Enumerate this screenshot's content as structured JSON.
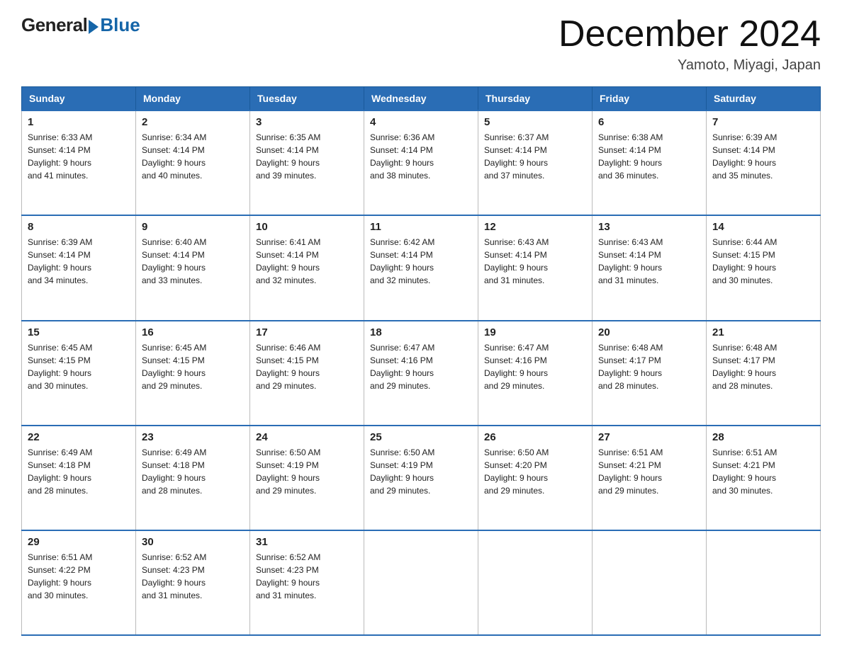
{
  "logo": {
    "general": "General",
    "blue": "Blue"
  },
  "title": "December 2024",
  "subtitle": "Yamoto, Miyagi, Japan",
  "days": [
    "Sunday",
    "Monday",
    "Tuesday",
    "Wednesday",
    "Thursday",
    "Friday",
    "Saturday"
  ],
  "weeks": [
    [
      {
        "day": "1",
        "sunrise": "6:33 AM",
        "sunset": "4:14 PM",
        "daylight": "9 hours and 41 minutes."
      },
      {
        "day": "2",
        "sunrise": "6:34 AM",
        "sunset": "4:14 PM",
        "daylight": "9 hours and 40 minutes."
      },
      {
        "day": "3",
        "sunrise": "6:35 AM",
        "sunset": "4:14 PM",
        "daylight": "9 hours and 39 minutes."
      },
      {
        "day": "4",
        "sunrise": "6:36 AM",
        "sunset": "4:14 PM",
        "daylight": "9 hours and 38 minutes."
      },
      {
        "day": "5",
        "sunrise": "6:37 AM",
        "sunset": "4:14 PM",
        "daylight": "9 hours and 37 minutes."
      },
      {
        "day": "6",
        "sunrise": "6:38 AM",
        "sunset": "4:14 PM",
        "daylight": "9 hours and 36 minutes."
      },
      {
        "day": "7",
        "sunrise": "6:39 AM",
        "sunset": "4:14 PM",
        "daylight": "9 hours and 35 minutes."
      }
    ],
    [
      {
        "day": "8",
        "sunrise": "6:39 AM",
        "sunset": "4:14 PM",
        "daylight": "9 hours and 34 minutes."
      },
      {
        "day": "9",
        "sunrise": "6:40 AM",
        "sunset": "4:14 PM",
        "daylight": "9 hours and 33 minutes."
      },
      {
        "day": "10",
        "sunrise": "6:41 AM",
        "sunset": "4:14 PM",
        "daylight": "9 hours and 32 minutes."
      },
      {
        "day": "11",
        "sunrise": "6:42 AM",
        "sunset": "4:14 PM",
        "daylight": "9 hours and 32 minutes."
      },
      {
        "day": "12",
        "sunrise": "6:43 AM",
        "sunset": "4:14 PM",
        "daylight": "9 hours and 31 minutes."
      },
      {
        "day": "13",
        "sunrise": "6:43 AM",
        "sunset": "4:14 PM",
        "daylight": "9 hours and 31 minutes."
      },
      {
        "day": "14",
        "sunrise": "6:44 AM",
        "sunset": "4:15 PM",
        "daylight": "9 hours and 30 minutes."
      }
    ],
    [
      {
        "day": "15",
        "sunrise": "6:45 AM",
        "sunset": "4:15 PM",
        "daylight": "9 hours and 30 minutes."
      },
      {
        "day": "16",
        "sunrise": "6:45 AM",
        "sunset": "4:15 PM",
        "daylight": "9 hours and 29 minutes."
      },
      {
        "day": "17",
        "sunrise": "6:46 AM",
        "sunset": "4:15 PM",
        "daylight": "9 hours and 29 minutes."
      },
      {
        "day": "18",
        "sunrise": "6:47 AM",
        "sunset": "4:16 PM",
        "daylight": "9 hours and 29 minutes."
      },
      {
        "day": "19",
        "sunrise": "6:47 AM",
        "sunset": "4:16 PM",
        "daylight": "9 hours and 29 minutes."
      },
      {
        "day": "20",
        "sunrise": "6:48 AM",
        "sunset": "4:17 PM",
        "daylight": "9 hours and 28 minutes."
      },
      {
        "day": "21",
        "sunrise": "6:48 AM",
        "sunset": "4:17 PM",
        "daylight": "9 hours and 28 minutes."
      }
    ],
    [
      {
        "day": "22",
        "sunrise": "6:49 AM",
        "sunset": "4:18 PM",
        "daylight": "9 hours and 28 minutes."
      },
      {
        "day": "23",
        "sunrise": "6:49 AM",
        "sunset": "4:18 PM",
        "daylight": "9 hours and 28 minutes."
      },
      {
        "day": "24",
        "sunrise": "6:50 AM",
        "sunset": "4:19 PM",
        "daylight": "9 hours and 29 minutes."
      },
      {
        "day": "25",
        "sunrise": "6:50 AM",
        "sunset": "4:19 PM",
        "daylight": "9 hours and 29 minutes."
      },
      {
        "day": "26",
        "sunrise": "6:50 AM",
        "sunset": "4:20 PM",
        "daylight": "9 hours and 29 minutes."
      },
      {
        "day": "27",
        "sunrise": "6:51 AM",
        "sunset": "4:21 PM",
        "daylight": "9 hours and 29 minutes."
      },
      {
        "day": "28",
        "sunrise": "6:51 AM",
        "sunset": "4:21 PM",
        "daylight": "9 hours and 30 minutes."
      }
    ],
    [
      {
        "day": "29",
        "sunrise": "6:51 AM",
        "sunset": "4:22 PM",
        "daylight": "9 hours and 30 minutes."
      },
      {
        "day": "30",
        "sunrise": "6:52 AM",
        "sunset": "4:23 PM",
        "daylight": "9 hours and 31 minutes."
      },
      {
        "day": "31",
        "sunrise": "6:52 AM",
        "sunset": "4:23 PM",
        "daylight": "9 hours and 31 minutes."
      },
      null,
      null,
      null,
      null
    ]
  ],
  "labels": {
    "sunrise": "Sunrise:",
    "sunset": "Sunset:",
    "daylight": "Daylight:"
  }
}
